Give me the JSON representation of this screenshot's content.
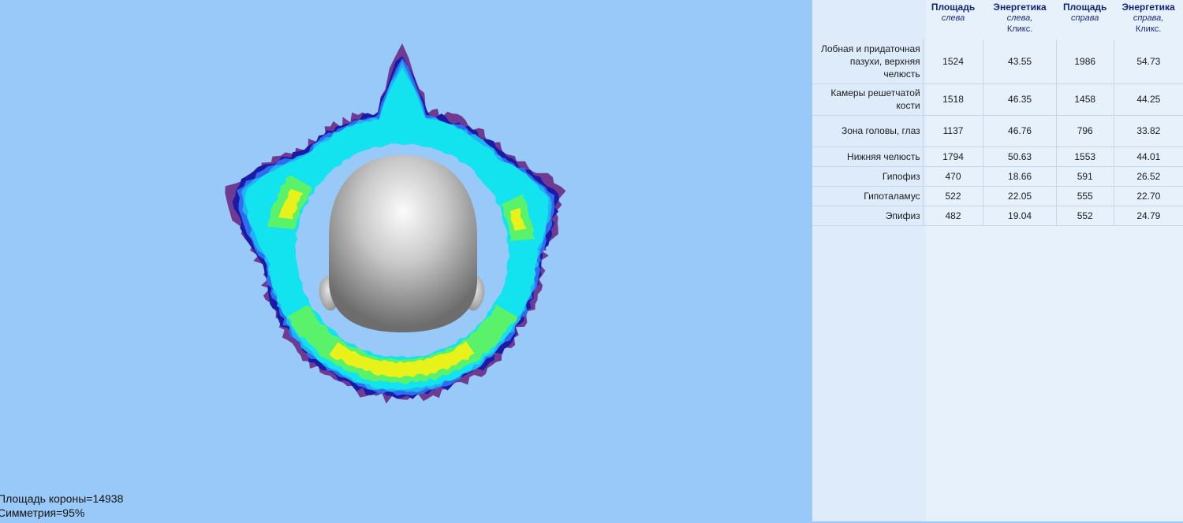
{
  "viewport": {
    "corona_area": "Площадь короны=14938",
    "symmetry": "Симметрия=95%",
    "head_icon": "head-model-icon",
    "colors": {
      "background": "#99c9f8",
      "outer_glow": "#6f3a92",
      "band_dark_blue": "#1a1aa6",
      "band_blue": "#2f6df0",
      "band_light_blue": "#1fb2f5",
      "band_cyan": "#12e3ef",
      "band_green": "#5af26a",
      "band_yellow": "#e8f21a"
    }
  },
  "table": {
    "headers": [
      {
        "title": "Площадь",
        "sub": "слева",
        "unit": ""
      },
      {
        "title": "Энергетика",
        "sub": "слева,",
        "unit": "Кликс."
      },
      {
        "title": "Площадь",
        "sub": "справа",
        "unit": ""
      },
      {
        "title": "Энергетика",
        "sub": "справа,",
        "unit": "Кликс."
      }
    ],
    "rows": [
      {
        "label": "Лобная и придаточная пазухи, верхняя челюсть",
        "values": [
          "1524",
          "43.55",
          "1986",
          "54.73"
        ]
      },
      {
        "label": "Камеры решетчатой кости",
        "values": [
          "1518",
          "46.35",
          "1458",
          "44.25"
        ]
      },
      {
        "label": "Зона головы, глаз",
        "values": [
          "1137",
          "46.76",
          "796",
          "33.82"
        ]
      },
      {
        "label": "Нижняя челюсть",
        "values": [
          "1794",
          "50.63",
          "1553",
          "44.01"
        ]
      },
      {
        "label": "Гипофиз",
        "values": [
          "470",
          "18.66",
          "591",
          "26.52"
        ]
      },
      {
        "label": "Гипоталамус",
        "values": [
          "522",
          "22.05",
          "555",
          "22.70"
        ]
      },
      {
        "label": "Эпифиз",
        "values": [
          "482",
          "19.04",
          "552",
          "24.79"
        ]
      }
    ]
  }
}
